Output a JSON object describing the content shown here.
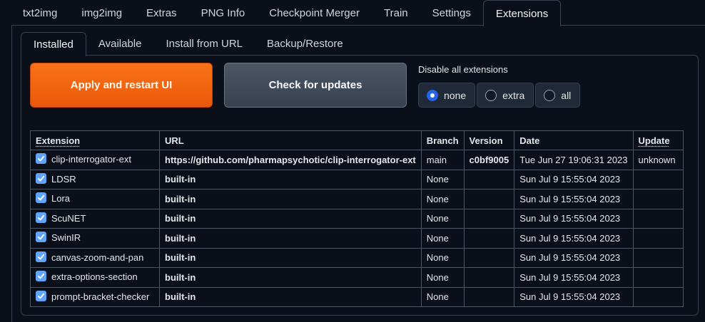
{
  "top_tabs": [
    {
      "label": "txt2img"
    },
    {
      "label": "img2img"
    },
    {
      "label": "Extras"
    },
    {
      "label": "PNG Info"
    },
    {
      "label": "Checkpoint Merger"
    },
    {
      "label": "Train"
    },
    {
      "label": "Settings"
    },
    {
      "label": "Extensions",
      "active": true
    }
  ],
  "sub_tabs": [
    {
      "label": "Installed",
      "active": true
    },
    {
      "label": "Available"
    },
    {
      "label": "Install from URL"
    },
    {
      "label": "Backup/Restore"
    }
  ],
  "buttons": {
    "apply_label": "Apply and restart UI",
    "check_label": "Check for updates"
  },
  "disable": {
    "label": "Disable all extensions",
    "options": [
      "none",
      "extra",
      "all"
    ],
    "selected": "none"
  },
  "table": {
    "headers": [
      "Extension",
      "URL",
      "Branch",
      "Version",
      "Date",
      "Update"
    ],
    "rows": [
      {
        "name": "clip-interrogator-ext",
        "url": "https://github.com/pharmapsychotic/clip-interrogator-ext",
        "branch": "main",
        "version": "c0bf9005",
        "date": "Tue Jun 27 19:06:31 2023",
        "update": "unknown",
        "checked": true
      },
      {
        "name": "LDSR",
        "url": "built-in",
        "branch": "None",
        "version": "",
        "date": "Sun Jul 9 15:55:04 2023",
        "update": "",
        "checked": true
      },
      {
        "name": "Lora",
        "url": "built-in",
        "branch": "None",
        "version": "",
        "date": "Sun Jul 9 15:55:04 2023",
        "update": "",
        "checked": true
      },
      {
        "name": "ScuNET",
        "url": "built-in",
        "branch": "None",
        "version": "",
        "date": "Sun Jul 9 15:55:04 2023",
        "update": "",
        "checked": true
      },
      {
        "name": "SwinIR",
        "url": "built-in",
        "branch": "None",
        "version": "",
        "date": "Sun Jul 9 15:55:04 2023",
        "update": "",
        "checked": true
      },
      {
        "name": "canvas-zoom-and-pan",
        "url": "built-in",
        "branch": "None",
        "version": "",
        "date": "Sun Jul 9 15:55:04 2023",
        "update": "",
        "checked": true
      },
      {
        "name": "extra-options-section",
        "url": "built-in",
        "branch": "None",
        "version": "",
        "date": "Sun Jul 9 15:55:04 2023",
        "update": "",
        "checked": true
      },
      {
        "name": "prompt-bracket-checker",
        "url": "built-in",
        "branch": "None",
        "version": "",
        "date": "Sun Jul 9 15:55:04 2023",
        "update": "",
        "checked": true
      }
    ]
  },
  "colors": {
    "background": "#0b0f19",
    "accent_orange": "#f97316",
    "checkbox_blue": "#60a5fa",
    "radio_blue": "#2563eb"
  }
}
